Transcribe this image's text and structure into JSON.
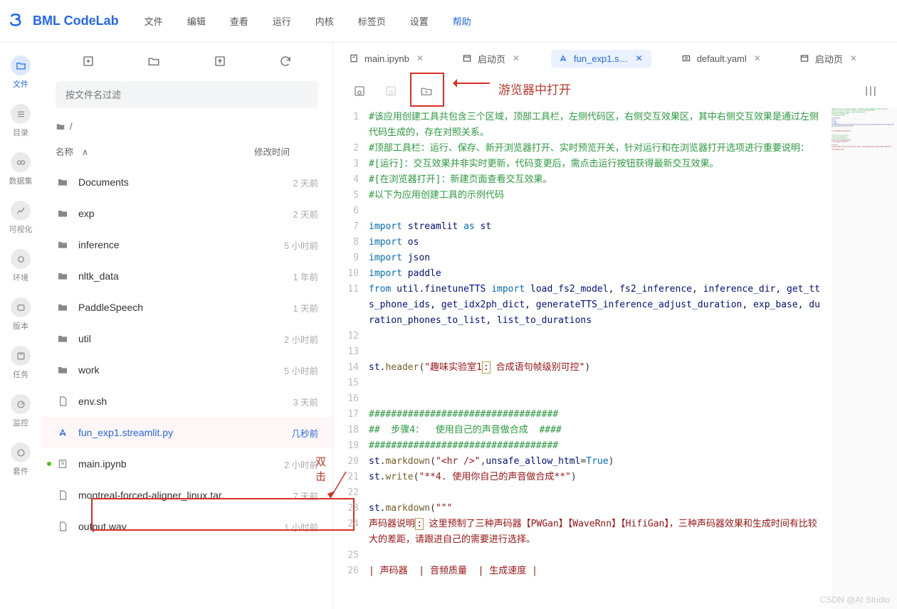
{
  "app": {
    "name": "BML CodeLab"
  },
  "menu": [
    "文件",
    "编辑",
    "查看",
    "运行",
    "内核",
    "标签页",
    "设置",
    "帮助"
  ],
  "menu_active_index": 7,
  "sidebar": [
    {
      "label": "文件",
      "icon": "folder-icon"
    },
    {
      "label": "目录",
      "icon": "list-icon"
    },
    {
      "label": "数据集",
      "icon": "link-icon"
    },
    {
      "label": "可视化",
      "icon": "chart-icon"
    },
    {
      "label": "环境",
      "icon": "circle-icon"
    },
    {
      "label": "版本",
      "icon": "version-icon"
    },
    {
      "label": "任务",
      "icon": "task-icon"
    },
    {
      "label": "监控",
      "icon": "gauge-icon"
    },
    {
      "label": "套件",
      "icon": "package-icon"
    }
  ],
  "sidebar_active_index": 0,
  "file_panel": {
    "filter_placeholder": "按文件名过滤",
    "breadcrumb": "/",
    "col_name": "名称",
    "col_time": "修改时间",
    "items": [
      {
        "name": "Documents",
        "time": "2 天前",
        "type": "folder"
      },
      {
        "name": "exp",
        "time": "2 天前",
        "type": "folder"
      },
      {
        "name": "inference",
        "time": "5 小时前",
        "type": "folder"
      },
      {
        "name": "nltk_data",
        "time": "1 年前",
        "type": "folder"
      },
      {
        "name": "PaddleSpeech",
        "time": "1 天前",
        "type": "folder"
      },
      {
        "name": "util",
        "time": "2 小时前",
        "type": "folder"
      },
      {
        "name": "work",
        "time": "5 小时前",
        "type": "folder"
      },
      {
        "name": "env.sh",
        "time": "3 天前",
        "type": "file"
      },
      {
        "name": "fun_exp1.streamlit.py",
        "time": "几秒前",
        "type": "streamlit",
        "selected": true
      },
      {
        "name": "main.ipynb",
        "time": "2 小时前",
        "type": "notebook",
        "running": true
      },
      {
        "name": "montreal-forced-aligner_linux.tar.",
        "time": "7 天前",
        "type": "file"
      },
      {
        "name": "output.wav",
        "time": "1 小时前",
        "type": "file"
      }
    ]
  },
  "tabs": [
    {
      "icon": "notebook-icon",
      "label": "main.ipynb",
      "active": false
    },
    {
      "icon": "launcher-icon",
      "label": "启动页",
      "active": false
    },
    {
      "icon": "streamlit-icon",
      "label": "fun_exp1.s…",
      "active": true
    },
    {
      "icon": "yaml-icon",
      "label": "default.yaml",
      "active": false
    },
    {
      "icon": "launcher-icon",
      "label": "启动页",
      "active": false
    }
  ],
  "editor_toolbar": {
    "annotation_open_browser": "游览器中打开",
    "annotation_dblclick": "双击"
  },
  "code_lines": [
    {
      "n": 1,
      "html": "<span class='c-green'>#该应用创建工具共包含三个区域，顶部工具栏，左侧代码区，右侧交互效果区，其中右侧交互效果是通过左侧代码生成的，存在对照关系。</span>"
    },
    {
      "n": 2,
      "html": "<span class='c-green'>#顶部工具栏：运行、保存、新开浏览器打开、实时预览开关，针对运行和在浏览器打开选项进行重要说明：</span>"
    },
    {
      "n": 3,
      "html": "<span class='c-green'>#[运行]：交互效果并非实时更新，代码变更后，需点击运行按钮获得最新交互效果。</span>"
    },
    {
      "n": 4,
      "html": "<span class='c-green'>#[在浏览器打开]：新建页面查看交互效果。</span>"
    },
    {
      "n": 5,
      "html": "<span class='c-green'>#以下为应用创建工具的示例代码</span>"
    },
    {
      "n": 6,
      "html": ""
    },
    {
      "n": 7,
      "html": "<span class='c-blue'>import</span> <span class='c-darkblue'>streamlit</span> <span class='c-blue'>as</span> <span class='c-darkblue'>st</span>"
    },
    {
      "n": 8,
      "html": "<span class='c-blue'>import</span> <span class='c-darkblue'>os</span>"
    },
    {
      "n": 9,
      "html": "<span class='c-blue'>import</span> <span class='c-darkblue'>json</span>"
    },
    {
      "n": 10,
      "html": "<span class='c-blue'>import</span> <span class='c-darkblue'>paddle</span>"
    },
    {
      "n": 11,
      "html": "<span class='c-blue'>from</span> <span class='c-darkblue'>util.finetuneTTS</span> <span class='c-blue'>import</span> <span class='c-darkblue'>load_fs2_model, fs2_inference, inference_dir, get_tts_phone_ids, get_idx2ph_dict, generateTTS_inference_adjust_duration, exp_base, duration_phones_to_list, list_to_durations</span>"
    },
    {
      "n": 12,
      "html": ""
    },
    {
      "n": 13,
      "html": ""
    },
    {
      "n": 14,
      "html": "<span class='c-darkblue'>st</span>.<span class='c-olive'>header</span>(<span class='c-red'>\"趣味实验室1<span class='c-box'>:</span> 合成语句帧级别可控\"</span>)"
    },
    {
      "n": 15,
      "html": ""
    },
    {
      "n": 16,
      "html": ""
    },
    {
      "n": 17,
      "html": "<span class='c-green'>##################################</span>"
    },
    {
      "n": 18,
      "html": "<span class='c-green'>##  步骤4：  使用自己的声音做合成  ####</span>"
    },
    {
      "n": 19,
      "html": "<span class='c-green'>##################################</span>"
    },
    {
      "n": 20,
      "html": "<span class='c-darkblue'>st</span>.<span class='c-olive'>markdown</span>(<span class='c-red'>\"&lt;hr /&gt;\"</span>,<span class='c-darkblue'>unsafe_allow_html</span>=<span class='c-blue'>True</span>)"
    },
    {
      "n": 21,
      "html": "<span class='c-darkblue'>st</span>.<span class='c-olive'>write</span>(<span class='c-red'>\"**4. 使用你自己的声音做合成**\"</span>)"
    },
    {
      "n": 22,
      "html": ""
    },
    {
      "n": 23,
      "html": "<span class='c-darkblue'>st</span>.<span class='c-olive'>markdown</span>(<span class='c-red'>\"\"\"</span>"
    },
    {
      "n": 24,
      "html": "<span class='c-red'>声码器说明<span class='c-box'>:</span> 这里预制了三种声码器【PWGan】【WaveRnn】【HifiGan】，三种声码器效果和生成时间有比较大的差距，请跟进自己的需要进行选择。</span>"
    },
    {
      "n": 25,
      "html": ""
    },
    {
      "n": 26,
      "html": "<span class='c-red'>| 声码器  | 音频质量  | 生成速度 |</span>"
    }
  ],
  "watermark": "CSDN @AI Studio"
}
